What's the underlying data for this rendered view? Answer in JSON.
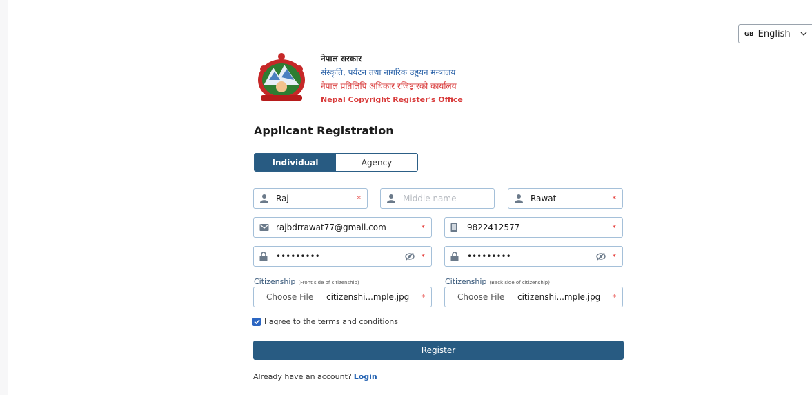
{
  "language": {
    "flag": "GB",
    "label": "English"
  },
  "header": {
    "line1": "नेपाल सरकार",
    "line2": "संस्कृति, पर्यटन तथा नागरिक उड्डयन मन्त्रालय",
    "line3": "नेपाल प्रतिलिपि अधिकार रजिष्ट्रारको कार्यालय",
    "line4": "Nepal Copyright Register's Office"
  },
  "title": "Applicant Registration",
  "tabs": [
    {
      "label": "Individual",
      "active": true
    },
    {
      "label": "Agency",
      "active": false
    }
  ],
  "form": {
    "first_name": {
      "value": "Raj",
      "required": "*"
    },
    "middle_name": {
      "placeholder": "Middle name"
    },
    "last_name": {
      "value": "Rawat",
      "required": "*"
    },
    "email": {
      "value": "rajbdrrawat77@gmail.com",
      "required": "*"
    },
    "phone": {
      "value": "9822412577",
      "required": "*"
    },
    "password": {
      "value": "•••••••••",
      "required": "*"
    },
    "confirm_password": {
      "value": "•••••••••",
      "required": "*"
    },
    "citizenship_front": {
      "label": "Citizenship",
      "sub": "(Front side of citizenship)",
      "button": "Choose File",
      "file": "citizenshi...mple.jpg",
      "required": "*"
    },
    "citizenship_back": {
      "label": "Citizenship",
      "sub": "(Back side of citizenship)",
      "button": "Choose File",
      "file": "citizenshi...mple.jpg",
      "required": "*"
    },
    "agree": {
      "label": "I agree to the terms and conditions",
      "checked": true
    },
    "register": "Register"
  },
  "footer": {
    "text": "Already have an account?",
    "link": "Login"
  },
  "colors": {
    "primary": "#285b82",
    "accent_red": "#d83a3a",
    "link": "#1f5fb0",
    "border": "#a5c0d9"
  }
}
